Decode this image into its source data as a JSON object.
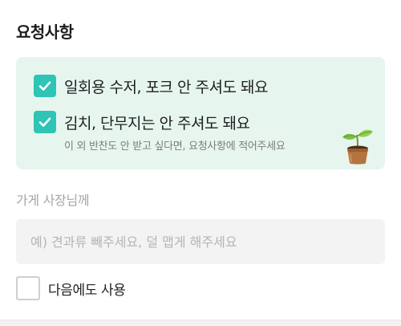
{
  "section": {
    "title": "요청사항"
  },
  "options": {
    "items": [
      {
        "label": "일회용 수저, 포크 안 주셔도 돼요",
        "checked": true
      },
      {
        "label": "김치, 단무지는 안 주셔도 돼요",
        "checked": true
      }
    ],
    "hint": "이 외 반찬도 안 받고 싶다면, 요청사항에 적어주세요",
    "illustration": "sprout-pot-icon"
  },
  "owner_request": {
    "label": "가게 사장님께",
    "value": "",
    "placeholder": "예) 견과류 빼주세요, 덜 맵게 해주세요"
  },
  "reuse": {
    "label": "다음에도 사용",
    "checked": false
  },
  "colors": {
    "accent": "#2ec4b6",
    "panel_bg": "#e6f6ef",
    "input_bg": "#f3f3f3"
  }
}
